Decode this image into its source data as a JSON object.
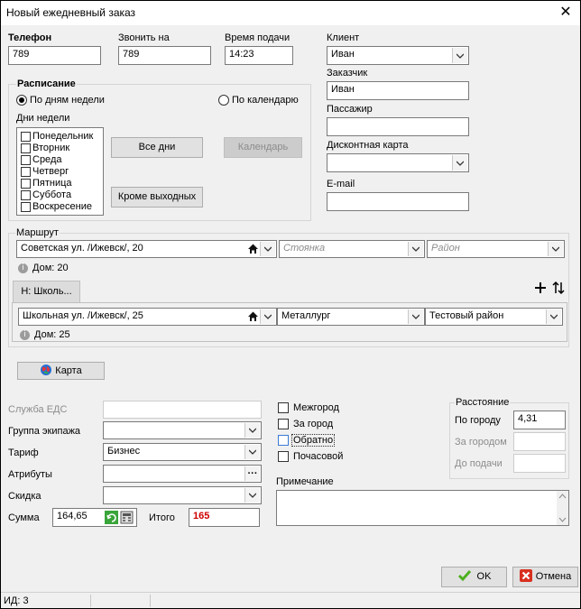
{
  "window": {
    "title": "Новый ежедневный заказ",
    "close": "✕"
  },
  "phone": {
    "label": "Телефон",
    "value": "789"
  },
  "call_to": {
    "label": "Звонить на",
    "value": "789"
  },
  "time": {
    "label": "Время подачи",
    "value": "14:23"
  },
  "schedule": {
    "label": "Расписание",
    "by_weekdays": "По дням недели",
    "by_calendar": "По календарю",
    "weekdays_label": "Дни недели",
    "days": [
      "Понедельник",
      "Вторник",
      "Среда",
      "Четверг",
      "Пятница",
      "Суббота",
      "Воскресение"
    ],
    "all_days": "Все дни",
    "calendar": "Календарь",
    "except_weekends": "Кроме выходных"
  },
  "client": {
    "label": "Клиент",
    "value": "Иван"
  },
  "customer": {
    "label": "Заказчик",
    "value": "Иван"
  },
  "passenger": {
    "label": "Пассажир",
    "value": ""
  },
  "discount_card": {
    "label": "Дисконтная карта",
    "value": ""
  },
  "email": {
    "label": "E-mail",
    "value": ""
  },
  "route": {
    "label": "Маршрут",
    "from_address": "Советская ул. /Ижевск/, 20",
    "from_parking": "Стоянка",
    "from_district": "Район",
    "from_house": "Дом: 20",
    "tab": "Н: Школь...",
    "to_address": "Школьная ул. /Ижевск/, 25",
    "to_parking": "Металлург",
    "to_district": "Тестовый район",
    "to_house": "Дом: 25",
    "map_button": "Карта"
  },
  "eds_service": {
    "label": "Служба ЕДС",
    "value": ""
  },
  "crew_group": {
    "label": "Группа экипажа",
    "value": ""
  },
  "tariff": {
    "label": "Тариф",
    "value": "Бизнес"
  },
  "attributes": {
    "label": "Атрибуты",
    "value": "",
    "dots": "···"
  },
  "discount": {
    "label": "Скидка",
    "value": ""
  },
  "sum": {
    "label": "Сумма",
    "value": "164,65"
  },
  "total": {
    "label": "Итого",
    "value": "165"
  },
  "options": {
    "intercity": "Межгород",
    "out_of_city": "За город",
    "return": "Обратно",
    "hourly": "Почасовой"
  },
  "distance": {
    "label": "Расстояние",
    "in_city": "По городу",
    "in_city_value": "4,31",
    "out_city": "За городом",
    "out_city_value": "",
    "to_pickup": "До подачи",
    "to_pickup_value": ""
  },
  "note": {
    "label": "Примечание",
    "value": ""
  },
  "buttons": {
    "ok": "OK",
    "cancel": "Отмена"
  },
  "status": {
    "id": "ИД: 3"
  },
  "colors": {
    "total_value": "#d00000",
    "ok_check": "#4caf20",
    "cancel_x": "#d83020"
  }
}
